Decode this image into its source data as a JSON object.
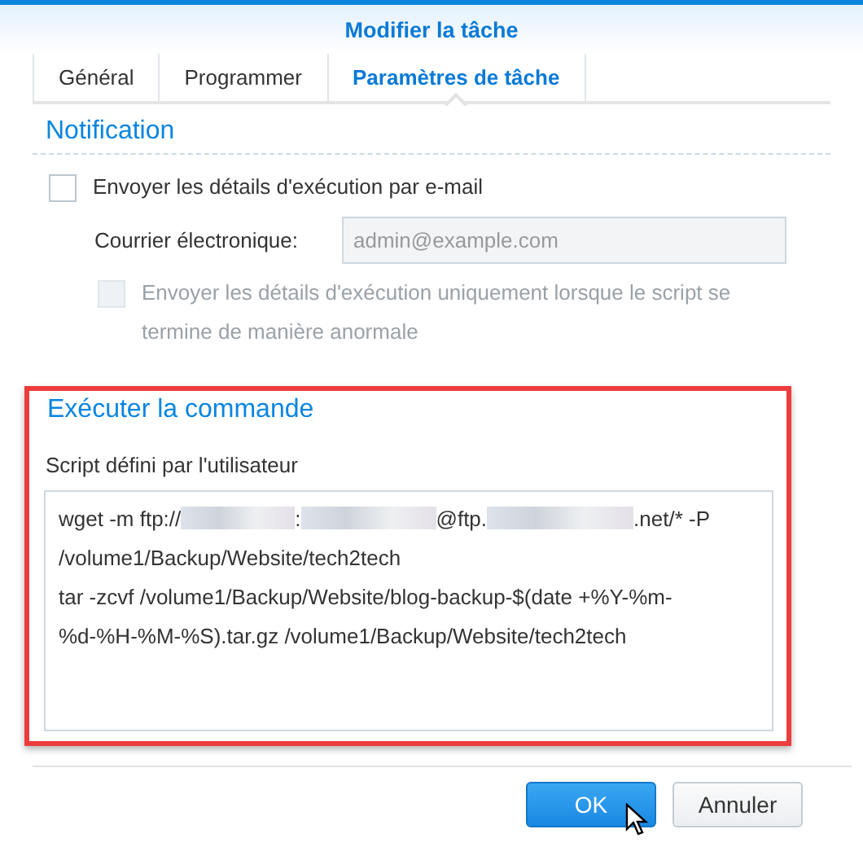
{
  "dialog": {
    "title": "Modifier la tâche"
  },
  "tabs": [
    {
      "label": "Général",
      "selected": false
    },
    {
      "label": "Programmer",
      "selected": false
    },
    {
      "label": "Paramètres de tâche",
      "selected": true
    }
  ],
  "notification": {
    "heading": "Notification",
    "email_checkbox": {
      "label": "Envoyer les détails d'exécution par e-mail",
      "checked": false
    },
    "email_field": {
      "label": "Courrier électronique:",
      "placeholder": "admin@example.com",
      "disabled": true
    },
    "abnormal_checkbox": {
      "label": "Envoyer les détails d'exécution uniquement lorsque le script se termine de manière anormale",
      "checked": false,
      "disabled": true
    }
  },
  "run_command": {
    "heading": "Exécuter la commande",
    "highlighted": true,
    "script_label": "Script défini par l'utilisateur",
    "script_lines": [
      [
        {
          "kind": "text",
          "text": "wget -m ftp://"
        },
        {
          "kind": "redacted"
        },
        {
          "kind": "text",
          "text": ":"
        },
        {
          "kind": "redacted"
        },
        {
          "kind": "text",
          "text": "@ftp."
        },
        {
          "kind": "redacted"
        },
        {
          "kind": "text",
          "text": ".net/* -P"
        }
      ],
      [
        {
          "kind": "text",
          "text": "/volume1/Backup/Website/tech2tech"
        }
      ],
      [
        {
          "kind": "text",
          "text": "tar -zcvf /volume1/Backup/Website/blog-backup-$(date +%Y-%m-"
        }
      ],
      [
        {
          "kind": "text",
          "text": "%d-%H-%M-%S).tar.gz /volume1/Backup/Website/tech2tech"
        }
      ]
    ]
  },
  "buttons": [
    {
      "label": "OK",
      "kind": "primary",
      "hovered": true
    },
    {
      "label": "Annuler",
      "kind": "secondary",
      "hovered": false
    }
  ]
}
